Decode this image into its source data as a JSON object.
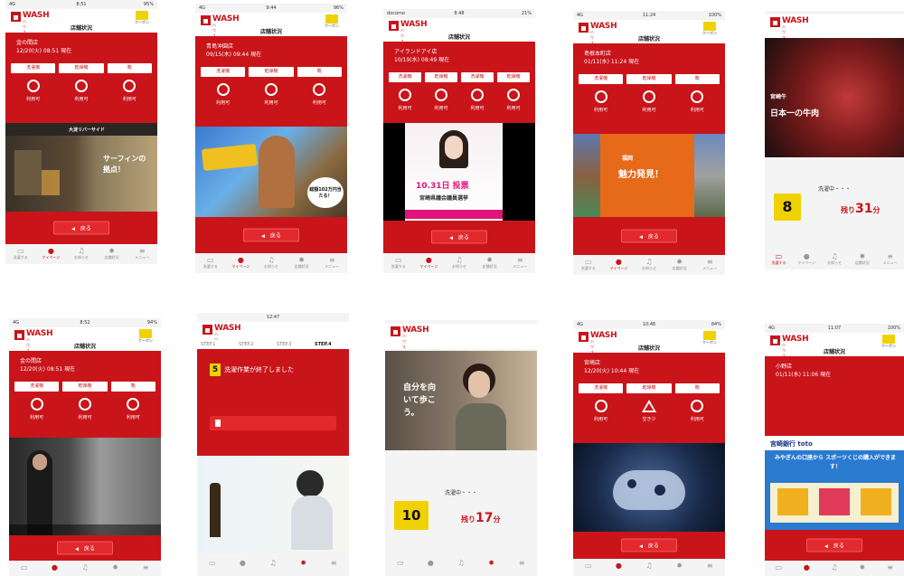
{
  "common": {
    "app_name": "WASH",
    "app_sub": "ハウス",
    "coupon": "クーポン",
    "page_title": "店舗状況",
    "back": "戻る",
    "machines": [
      "洗濯機",
      "乾燥機",
      "靴"
    ],
    "available": "利用可",
    "few_left": "空き少",
    "tabs": [
      "洗濯する",
      "マイページ",
      "お知らせ",
      "店舗状況",
      "メニュー"
    ]
  },
  "phones": [
    {
      "status": {
        "left": "4G",
        "center": "8:51",
        "right": "95%"
      },
      "store": "金の間店",
      "time": "12/20(火) 08:51 現在",
      "ad": {
        "label": "大淀リバーサイド",
        "text": "サーフィンの拠点！"
      }
    },
    {
      "status": {
        "left": "4G",
        "center": "9:44",
        "right": "96%"
      },
      "store": "青島沖園店",
      "time": "09/15(木) 09:44 現在",
      "ad": {
        "label": "",
        "text": "総額102万円当たる！"
      }
    },
    {
      "status": {
        "left": "docomo",
        "center": "8:48",
        "right": "21%"
      },
      "store": "アイランドアイ店",
      "time": "10/19(水) 08:49 現在",
      "ad": {
        "label": "10.31日 投票",
        "text": "宮崎県議会議員選挙"
      }
    },
    {
      "status": {
        "left": "4G",
        "center": "11:24",
        "right": "100%"
      },
      "store": "島根本町店",
      "time": "01/11(水) 11:24 現在",
      "ad": {
        "label": "福岡",
        "text": "魅力発見！"
      }
    },
    {
      "status": {
        "left": "",
        "center": "",
        "right": ""
      },
      "washing": "洗濯中・・・",
      "number": "8",
      "remain": "31",
      "remain_pre": "残り",
      "remain_unit": "分",
      "ad": {
        "label": "日本一の牛肉",
        "text": "宮崎牛"
      }
    },
    {
      "status": {
        "left": "4G",
        "center": "8:52",
        "right": "94%"
      },
      "store": "金の間店",
      "time": "12/20(火) 08:51 現在",
      "ad": {
        "label": "",
        "text": ""
      }
    },
    {
      "status": {
        "left": "",
        "center": "12:47",
        "right": ""
      },
      "steps": [
        "STEP.1",
        "STEP.2",
        "STEP.3",
        "STEP.4"
      ],
      "done_num": "5",
      "done_msg": "洗濯作業が終了しました",
      "ad": {
        "label": "",
        "text": ""
      }
    },
    {
      "status": {
        "left": "",
        "center": "",
        "right": ""
      },
      "washing": "洗濯中・・・",
      "number": "10",
      "remain": "17",
      "remain_pre": "残り",
      "remain_unit": "分",
      "ad": {
        "label": "自分を向いて歩こう。",
        "text": ""
      }
    },
    {
      "status": {
        "left": "4G",
        "center": "10:46",
        "right": "84%"
      },
      "store": "宮崎店",
      "time": "12/20(火) 10:44 現在",
      "ad": {
        "label": "",
        "text": ""
      }
    },
    {
      "status": {
        "left": "4G",
        "center": "11:07",
        "right": "100%"
      },
      "store": "小野店",
      "time": "01/11(水) 11:06 現在",
      "ad": {
        "label": "宮崎銀行 toto",
        "text": "みやぎんの口座から スポーツくじの購入ができます！"
      }
    }
  ],
  "colors": {
    "brand_red": "#c9141a",
    "yellow": "#f0d200"
  }
}
